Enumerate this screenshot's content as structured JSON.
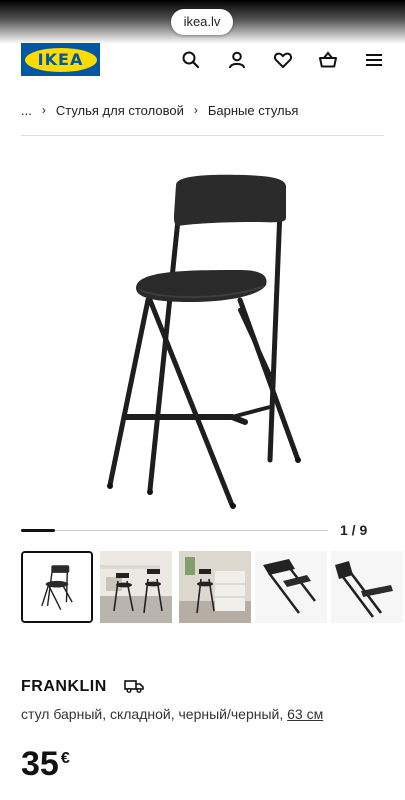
{
  "browser": {
    "url": "ikea.lv"
  },
  "header": {
    "logo_text": "IKEA",
    "brand_blue": "#0058a3",
    "brand_yellow": "#ffdb00",
    "icons": [
      "search-icon",
      "user-icon",
      "heart-icon",
      "basket-icon",
      "menu-icon"
    ]
  },
  "breadcrumb": {
    "ellipsis": "...",
    "items": [
      "Стулья для столовой",
      "Барные стулья"
    ],
    "separator": "›"
  },
  "gallery": {
    "counter": "1 / 9",
    "current": 1,
    "total": 9,
    "progress_fraction": 0.11,
    "thumbnails": [
      "thumb-chair-product",
      "thumb-chair-room-desk",
      "thumb-chair-room-drawers",
      "thumb-chair-folding-closeup",
      "thumb-chair-folded-closeup"
    ]
  },
  "product": {
    "name": "FRANKLIN",
    "description": "стул барный, складной, черный/черный, ",
    "size_link": "63 см",
    "price": "35",
    "currency": "€"
  }
}
